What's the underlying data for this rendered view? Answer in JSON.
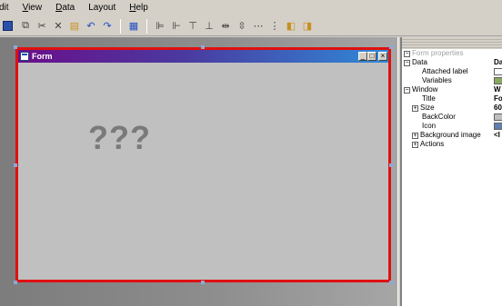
{
  "menubar": {
    "items": [
      {
        "label": "Edit",
        "display": "dit",
        "ul": ""
      },
      {
        "label": "View",
        "display": "iew",
        "ul": "V"
      },
      {
        "label": "Data",
        "display": "ata",
        "ul": "D"
      },
      {
        "label": "Layout",
        "display": "Layout",
        "ul": ""
      },
      {
        "label": "Help",
        "display": "elp",
        "ul": "H"
      }
    ]
  },
  "toolbar": {
    "icons": [
      "save-icon",
      "copy-icon",
      "cut-icon",
      "delete-icon",
      "paste-icon",
      "undo-icon",
      "redo-icon",
      "grid-icon",
      "align-left-icon",
      "align-right-icon",
      "align-top-icon",
      "align-bottom-icon",
      "center-horizontal-icon",
      "center-vertical-icon",
      "distribute-icon",
      "distribute-vertical-icon",
      "bring-front-icon",
      "send-back-icon"
    ]
  },
  "form": {
    "title": "Form",
    "placeholder": "???"
  },
  "properties": {
    "header": "Form properties",
    "rows": [
      {
        "label": "Data",
        "type": "group",
        "value": "Da"
      },
      {
        "label": "Attached label",
        "type": "sub",
        "box": "pencil"
      },
      {
        "label": "Variables",
        "type": "sub",
        "box": "vars"
      },
      {
        "label": "Window",
        "type": "group",
        "value": "W"
      },
      {
        "label": "Title",
        "type": "sub",
        "value": "Fo"
      },
      {
        "label": "Size",
        "type": "subgroup",
        "value": "60"
      },
      {
        "label": "BackColor",
        "type": "sub",
        "box": "color"
      },
      {
        "label": "Icon",
        "type": "sub",
        "box": "icon"
      },
      {
        "label": "Background image",
        "type": "subgroup",
        "value": "<I"
      },
      {
        "label": "Actions",
        "type": "subgroup"
      }
    ]
  }
}
